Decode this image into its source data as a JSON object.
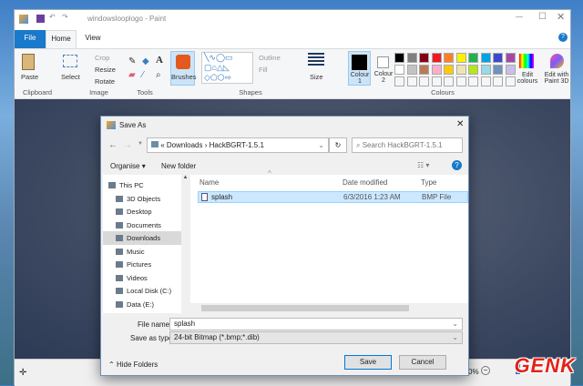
{
  "paint": {
    "title": "windowslooplogo - Paint",
    "tabs": {
      "file": "File",
      "home": "Home",
      "view": "View"
    },
    "clipboard": {
      "paste": "Paste",
      "group": "Clipboard"
    },
    "image": {
      "select": "Select",
      "crop": "Crop",
      "resize": "Resize",
      "rotate": "Rotate",
      "group": "Image"
    },
    "tools": {
      "group": "Tools"
    },
    "brushes": "Brushes",
    "shapes": {
      "outline": "Outline",
      "fill": "Fill",
      "group": "Shapes"
    },
    "size": "Size",
    "colour1": "Colour 1",
    "colour2": "Colour 2",
    "edit_colours": "Edit colours",
    "paint3d": "Edit with Paint 3D",
    "colours_group": "Colours",
    "palette_row1": [
      "#000000",
      "#7f7f7f",
      "#880015",
      "#ed1c24",
      "#ff7f27",
      "#fff200",
      "#22b14c",
      "#00a2e8",
      "#3f48cc",
      "#a349a4"
    ],
    "palette_row2": [
      "#ffffff",
      "#c3c3c3",
      "#b97a57",
      "#ffaec9",
      "#ffc90e",
      "#efe4b0",
      "#b5e61d",
      "#99d9ea",
      "#7092be",
      "#c8bfe7"
    ],
    "zoom_text": "0%"
  },
  "dialog": {
    "title": "Save As",
    "path": [
      "Downloads",
      "HackBGRT-1.5.1"
    ],
    "search_placeholder": "Search HackBGRT-1.5.1",
    "organise": "Organise",
    "new_folder": "New folder",
    "nav": [
      "This PC",
      "3D Objects",
      "Desktop",
      "Documents",
      "Downloads",
      "Music",
      "Pictures",
      "Videos",
      "Local Disk (C:)",
      "Data (E:)"
    ],
    "columns": {
      "name": "Name",
      "date": "Date modified",
      "type": "Type"
    },
    "files": [
      {
        "name": "splash",
        "date": "6/3/2016 1:23 AM",
        "type": "BMP File"
      }
    ],
    "file_name_label": "File name:",
    "file_name": "splash",
    "save_type_label": "Save as type:",
    "save_type": "24-bit Bitmap (*.bmp;*.dib)",
    "hide_folders": "Hide Folders",
    "save": "Save",
    "cancel": "Cancel"
  },
  "watermark": "GENK"
}
